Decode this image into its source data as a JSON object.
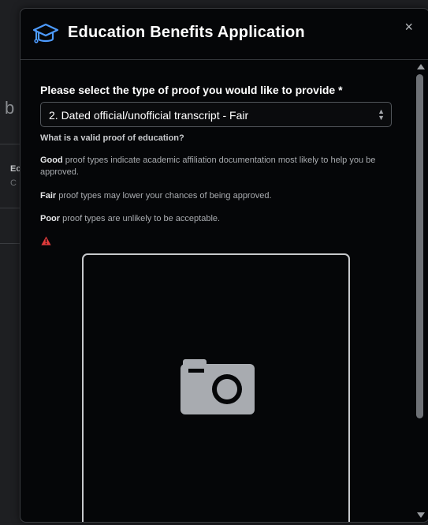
{
  "background": {
    "partial_heading": "b",
    "partial_item_title": "Ec",
    "partial_item_sub": "C"
  },
  "modal": {
    "title": "Education Benefits Application",
    "title_icon": "graduation-cap-icon",
    "close_label": "×",
    "accent_color": "#4d9bff"
  },
  "form": {
    "proof_label": "Please select the type of proof you would like to provide *",
    "proof_selected": "2. Dated official/unofficial transcript - Fair",
    "help_question": "What is a valid proof of education?",
    "good_term": "Good",
    "good_text": " proof types indicate academic affiliation documentation most likely to help you be approved.",
    "fair_term": "Fair",
    "fair_text": " proof types may lower your chances of being approved.",
    "poor_term": "Poor",
    "poor_text": " proof types are unlikely to be acceptable.",
    "warning_icon": "warning-icon",
    "warning_color": "#e03b3b",
    "upload_icon": "camera-icon"
  }
}
